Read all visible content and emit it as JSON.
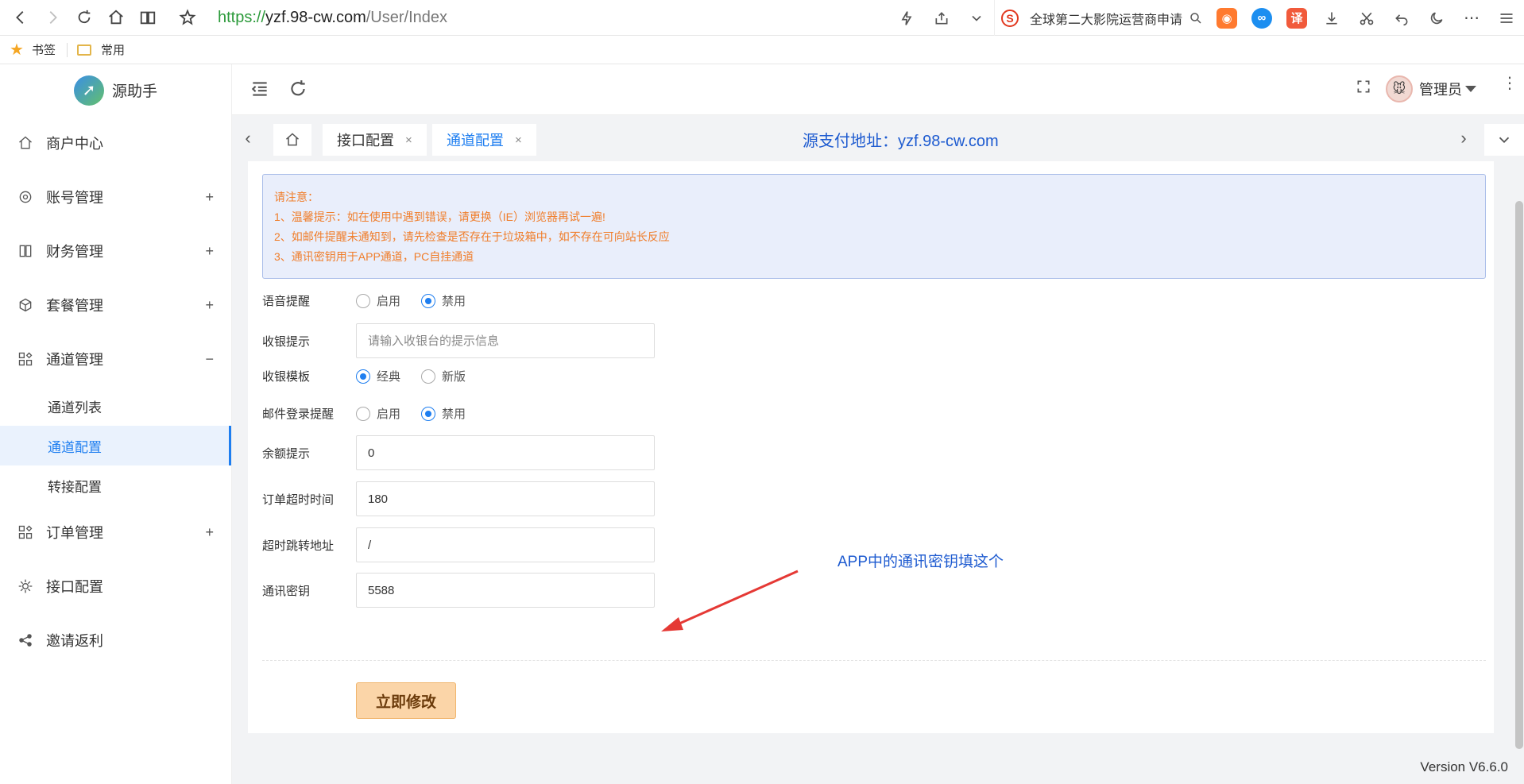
{
  "browser": {
    "url_proto": "https://",
    "url_host": "yzf.98-cw.com",
    "url_path": "/User/Index",
    "search_text": "全球第二大影院运营商申请",
    "translate_label": "译"
  },
  "bookmarks": [
    {
      "label": "书签",
      "icon": "star-icon"
    },
    {
      "label": "常用",
      "icon": "folder-icon"
    }
  ],
  "sidebar": {
    "logo_text": "源助手",
    "items": [
      {
        "label": "商户中心",
        "icon": "home-icon",
        "toggle": ""
      },
      {
        "label": "账号管理",
        "icon": "gear-icon",
        "toggle": "+"
      },
      {
        "label": "财务管理",
        "icon": "book-icon",
        "toggle": "+"
      },
      {
        "label": "套餐管理",
        "icon": "cube-icon",
        "toggle": "+"
      },
      {
        "label": "通道管理",
        "icon": "grid-icon",
        "toggle": "−"
      },
      {
        "label": "订单管理",
        "icon": "grid-icon",
        "toggle": "+"
      },
      {
        "label": "接口配置",
        "icon": "cog-icon",
        "toggle": ""
      },
      {
        "label": "邀请返利",
        "icon": "share-icon",
        "toggle": ""
      }
    ],
    "sub_items": [
      {
        "label": "通道列表"
      },
      {
        "label": "通道配置"
      },
      {
        "label": "转接配置"
      }
    ]
  },
  "header": {
    "user_name": "管理员"
  },
  "tabs": {
    "items": [
      {
        "label": "接口配置",
        "close": "×"
      },
      {
        "label": "通道配置",
        "close": "×"
      }
    ],
    "pay_address": "源支付地址：yzf.98-cw.com"
  },
  "notice": {
    "title": "请注意：",
    "lines": [
      "1、温馨提示：如在使用中遇到错误，请更换（IE）浏览器再试一遍!",
      "2、如邮件提醒未通知到，请先检查是否存在于垃圾箱中，如不存在可向站长反应",
      "3、通讯密钥用于APP通道，PC自挂通道"
    ]
  },
  "form": {
    "voice_alert": {
      "label": "语音提醒",
      "options": [
        "启用",
        "禁用"
      ],
      "selected": "禁用"
    },
    "cashier_tip": {
      "label": "收银提示",
      "value": "",
      "placeholder": "请输入收银台的提示信息"
    },
    "cashier_template": {
      "label": "收银模板",
      "options": [
        "经典",
        "新版"
      ],
      "selected": "经典"
    },
    "mail_login_alert": {
      "label": "邮件登录提醒",
      "options": [
        "启用",
        "禁用"
      ],
      "selected": "禁用"
    },
    "balance_tip": {
      "label": "余额提示",
      "value": "0"
    },
    "order_timeout": {
      "label": "订单超时时间",
      "value": "180"
    },
    "timeout_redirect": {
      "label": "超时跳转地址",
      "value": "/"
    },
    "comm_key": {
      "label": "通讯密钥",
      "value": "5588"
    },
    "submit_label": "立即修改"
  },
  "annotation_text": "APP中的通讯密钥填这个",
  "footer": {
    "version": "Version V6.6.0"
  },
  "colors": {
    "accent": "#1e7ef0",
    "notice_text": "#f07d2a",
    "notice_bg": "#e9eefb",
    "submit_bg": "#fbd5a8",
    "annotation": "#1e5bd0",
    "arrow": "#e53935"
  }
}
